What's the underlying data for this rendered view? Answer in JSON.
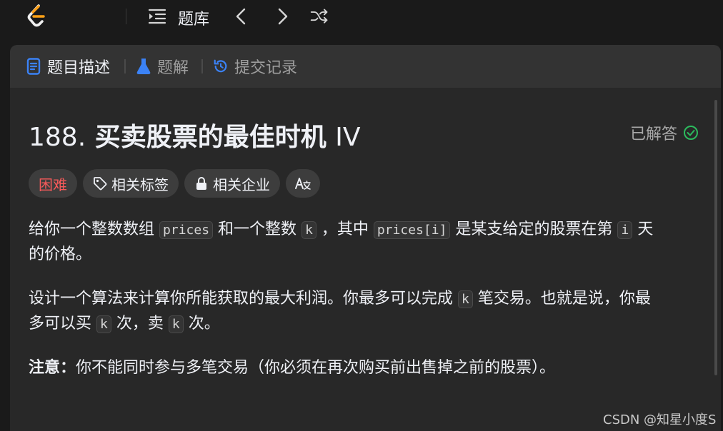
{
  "topbar": {
    "title": "题库"
  },
  "tabs": {
    "description": "题目描述",
    "solutions": "题解",
    "submissions": "提交记录"
  },
  "problem": {
    "number": "188.",
    "title": "买卖股票的最佳时机",
    "title_suffix": "IV",
    "status": "已解答",
    "tags": {
      "difficulty": "困难",
      "related_tags": "相关标签",
      "related_companies": "相关企业"
    },
    "p1": {
      "t1": "给你一个整数数组",
      "c1": "prices",
      "t2": "和一个整数",
      "c2": "k",
      "t3": "，其中",
      "c3": "prices[i]",
      "t4": "是某支给定的股票在第",
      "c4": "i",
      "t5": "天",
      "line2": "的价格。"
    },
    "p2": {
      "t1": "设计一个算法来计算你所能获取的最大利润。你最多可以完成",
      "c1": "k",
      "t2": "笔交易。也就是说，你最",
      "t3": "多可以买",
      "c2": "k",
      "t4": "次，卖",
      "c3": "k",
      "t5": "次。"
    },
    "note": {
      "label": "注意：",
      "text": "你不能同时参与多笔交易（你必须在再次购买前出售掉之前的股票）。"
    }
  },
  "watermark": "CSDN @知星小度S",
  "colors": {
    "hard": "#f75a5a",
    "solved": "#2cbb5d",
    "tab_active_icon": "#3b82f6"
  }
}
